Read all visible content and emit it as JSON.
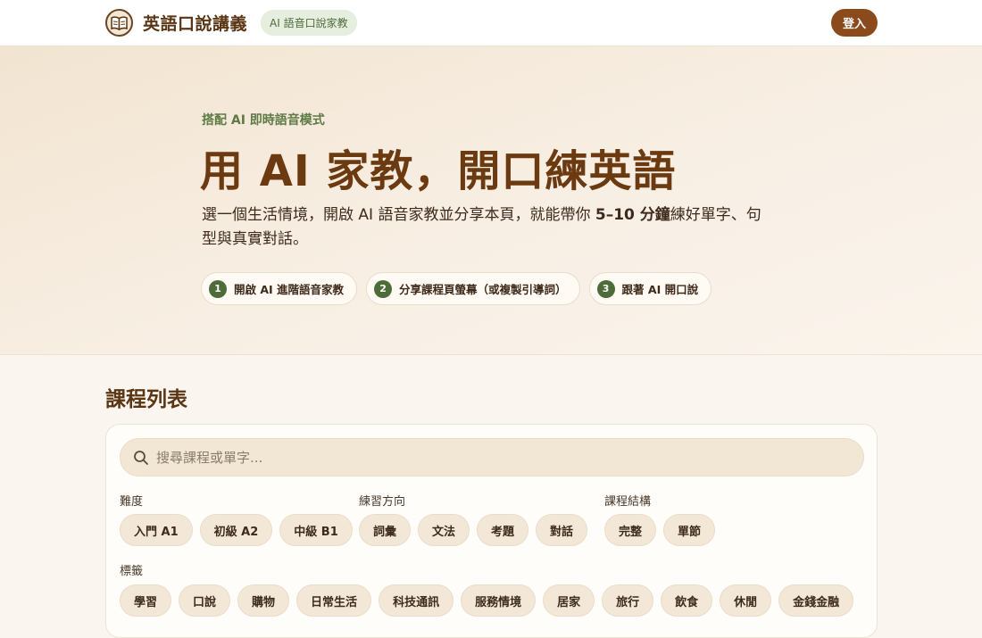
{
  "header": {
    "brand_name": "英語口說講義",
    "brand_chip": "AI 語音口說家教",
    "login_label": "登入"
  },
  "hero": {
    "eyebrow": "搭配 AI 即時語音模式",
    "title": "用 AI 家教，開口練英語",
    "desc_part1": "選一個生活情境，開啟 AI 語音家教並分享本頁，就能帶你 ",
    "desc_bold": "5–10 分鐘",
    "desc_part2": "練好單字、句型與真實對話。",
    "steps": [
      {
        "num": "1",
        "label": "開啟 AI 進階語音家教"
      },
      {
        "num": "2",
        "label": "分享課程頁螢幕（或複製引導詞）"
      },
      {
        "num": "3",
        "label": "跟著 AI 開口說"
      }
    ]
  },
  "course_list": {
    "title": "課程列表",
    "search_placeholder": "搜尋課程或單字...",
    "filters": {
      "difficulty": {
        "label": "難度",
        "options": [
          "入門 A1",
          "初級 A2",
          "中級 B1"
        ]
      },
      "direction": {
        "label": "練習方向",
        "options": [
          "詞彙",
          "文法",
          "考題",
          "對話"
        ]
      },
      "structure": {
        "label": "課程結構",
        "options": [
          "完整",
          "單節"
        ]
      },
      "tags": {
        "label": "標籤",
        "options": [
          "學習",
          "口說",
          "購物",
          "日常生活",
          "科技通訊",
          "服務情境",
          "居家",
          "旅行",
          "飲食",
          "休閒",
          "金錢金融"
        ]
      }
    }
  },
  "icons": {
    "logo": "open-book-icon",
    "search": "search-icon"
  },
  "colors": {
    "brand_brown": "#8b4a1c",
    "title_brown": "#6b3a10",
    "accent_green": "#4e6b3a"
  }
}
